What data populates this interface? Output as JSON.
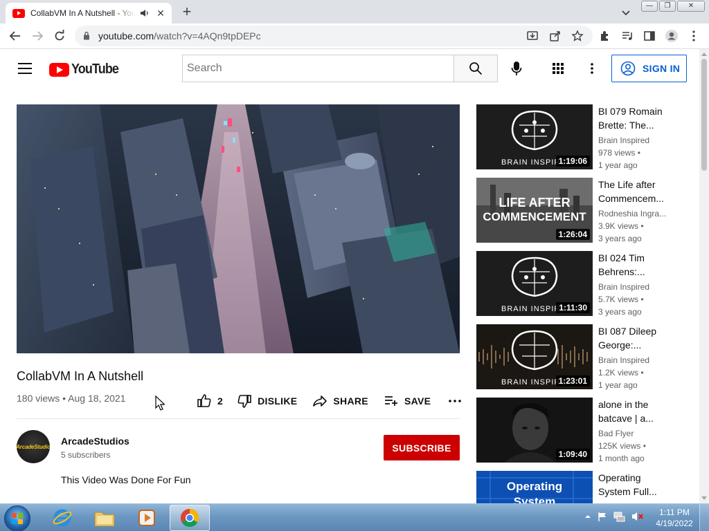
{
  "browser": {
    "tab_title": "CollabVM In A Nutshell - YouTube",
    "new_tab_label": "+",
    "close_label": "✕",
    "url_host": "youtube.com",
    "url_path": "/watch?v=4AQn9tpDEPc"
  },
  "window_controls": {
    "minimize": "—",
    "maximize": "❐",
    "close": "✕"
  },
  "header": {
    "logo_text": "YouTube",
    "search_placeholder": "Search",
    "sign_in_label": "SIGN IN"
  },
  "video": {
    "title": "CollabVM In A Nutshell",
    "views_date": "180 views • Aug 18, 2021",
    "like_count": "2",
    "dislike_label": "DISLIKE",
    "share_label": "SHARE",
    "save_label": "SAVE"
  },
  "channel": {
    "name": "ArcadeStudios",
    "subscribers": "5 subscribers",
    "avatar_text": "ArcadeStudio",
    "subscribe_label": "SUBSCRIBE",
    "description": "This Video Was Done For Fun"
  },
  "related": [
    {
      "title": "BI 079 Romain Brette: The...",
      "channel": "Brain Inspired",
      "views": "978 views •",
      "age": "1 year ago",
      "duration": "1:19:06",
      "thumb_text": "BRAIN INSPIRED"
    },
    {
      "title": "The Life after Commencem...",
      "channel": "Rodneshia Ingra...",
      "views": "3.9K views •",
      "age": "3 years ago",
      "duration": "1:26:04",
      "thumb_line1": "LIFE AFTER",
      "thumb_line2": "COMMENCEMENT"
    },
    {
      "title": "BI 024 Tim Behrens:...",
      "channel": "Brain Inspired",
      "views": "5.7K views •",
      "age": "3 years ago",
      "duration": "1:11:30",
      "thumb_text": "BRAIN INSPIRED"
    },
    {
      "title": "BI 087 Dileep George:...",
      "channel": "Brain Inspired",
      "views": "1.2K views •",
      "age": "1 year ago",
      "duration": "1:23:01",
      "thumb_text": "BRAIN INSPIRED"
    },
    {
      "title": "alone in the batcave | a...",
      "channel": "Bad Flyer",
      "views": "125K views •",
      "age": "1 month ago",
      "duration": "1:09:40"
    },
    {
      "title": "Operating System Full...",
      "thumb_line1": "Operating",
      "thumb_line2": "System"
    }
  ],
  "taskbar": {
    "time": "1:11 PM",
    "date": "4/19/2022"
  },
  "colors": {
    "youtube_red": "#ff0000",
    "subscribe_red": "#cc0000",
    "sign_in_blue": "#065fd4"
  }
}
